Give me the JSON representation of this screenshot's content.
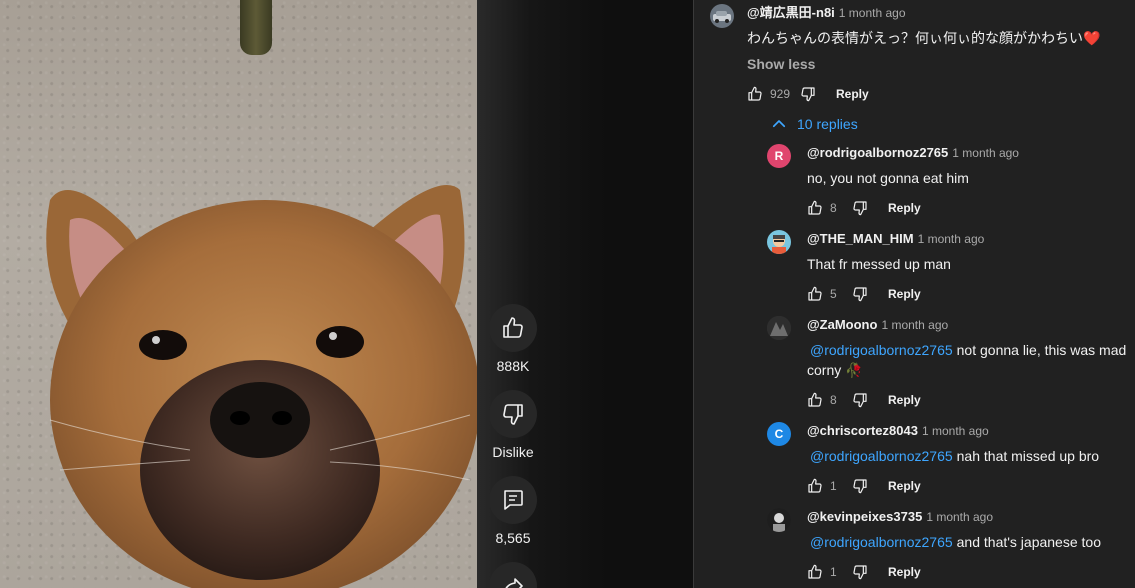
{
  "video": {
    "like_count": "888K",
    "dislike_label": "Dislike",
    "comment_count": "8,565"
  },
  "comment": {
    "author": "@靖広黒田-n8i",
    "time": "1 month ago",
    "text": "わんちゃんの表情がえっ？何ぃ何ぃ的な顔がかわちい",
    "heart": "❤️",
    "show_less": "Show less",
    "likes": "929",
    "reply_label": "Reply"
  },
  "replies_toggle": "10 replies",
  "replies": [
    {
      "author": "@rodrigoalbornoz2765",
      "time": "1 month ago",
      "avatar_letter": "R",
      "avatar_color": "#e0456e",
      "mention": "",
      "text": "no, you not gonna eat him",
      "likes": "8",
      "reply_label": "Reply"
    },
    {
      "author": "@THE_MAN_HIM",
      "time": "1 month ago",
      "avatar_letter": "",
      "avatar_color": "#79c6e0",
      "mention": "",
      "text": "That fr messed up man",
      "likes": "5",
      "reply_label": "Reply"
    },
    {
      "author": "@ZaMoono",
      "time": "1 month ago",
      "avatar_letter": "",
      "avatar_color": "#3a3a3a",
      "mention": "@rodrigoalbornoz2765",
      "text": "not gonna lie, this was mad corny 🥀",
      "likes": "8",
      "reply_label": "Reply"
    },
    {
      "author": "@chriscortez8043",
      "time": "1 month ago",
      "avatar_letter": "C",
      "avatar_color": "#1e88e5",
      "mention": "@rodrigoalbornoz2765",
      "text": "nah that missed up bro",
      "likes": "1",
      "reply_label": "Reply"
    },
    {
      "author": "@kevinpeixes3735",
      "time": "1 month ago",
      "avatar_letter": "",
      "avatar_color": "#2b2b2b",
      "mention": "@rodrigoalbornoz2765",
      "text": "and that's japanese too",
      "likes": "1",
      "reply_label": "Reply"
    }
  ],
  "colors": {
    "link": "#3ea6ff",
    "panel_bg": "#212121",
    "page_bg": "#0f0f0f"
  }
}
